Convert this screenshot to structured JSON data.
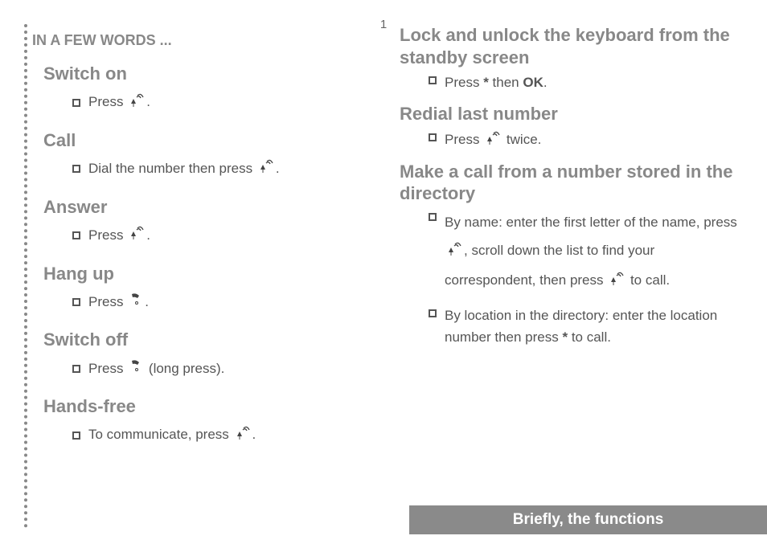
{
  "page_number": "1",
  "left": {
    "title": "IN A FEW WORDS ...",
    "sections": {
      "switch_on": {
        "heading": "Switch on",
        "text_a": "Press ",
        "text_b": "."
      },
      "call": {
        "heading": "Call",
        "text_a": "Dial the number then press ",
        "text_b": "."
      },
      "answer": {
        "heading": "Answer",
        "text_a": "Press ",
        "text_b": "."
      },
      "hang_up": {
        "heading": "Hang up",
        "text_a": "Press ",
        "text_b": "."
      },
      "switch_off": {
        "heading": "Switch off",
        "text_a": "Press ",
        "text_b": " (long press)."
      },
      "hands_free": {
        "heading": "Hands-free",
        "text_a": "To communicate, press ",
        "text_b": "."
      }
    }
  },
  "right": {
    "lock": {
      "heading": "Lock and unlock the keyboard from the standby screen",
      "text_a": "Press ",
      "star": "*",
      "text_b": " then ",
      "ok": "OK",
      "text_c": "."
    },
    "redial": {
      "heading": "Redial last number",
      "text_a": "Press ",
      "text_b": " twice."
    },
    "directory": {
      "heading": "Make a call from a number stored in the directory",
      "by_name_a": "By name: enter the first letter of the name, press ",
      "by_name_b": ", scroll down the list to find your correspondent, then press ",
      "by_name_c": " to call.",
      "by_loc_a": "By location in the directory: enter the location number then press ",
      "by_loc_star": "*",
      "by_loc_b": " to call."
    }
  },
  "footer": "Briefly, the functions"
}
